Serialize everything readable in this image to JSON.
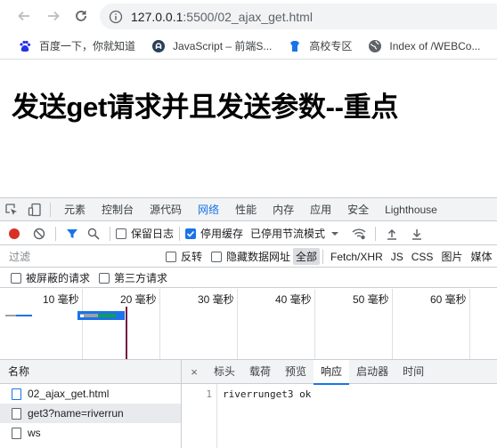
{
  "browser": {
    "url_host": "127.0.0.1",
    "url_path": ":5500/02_ajax_get.html"
  },
  "bookmarks": [
    {
      "label": "百度一下，你就知道",
      "icon": "baidu-icon"
    },
    {
      "label": "JavaScript – 前端S...",
      "icon": "site-icon"
    },
    {
      "label": "高校专区",
      "icon": "tshirt-icon"
    },
    {
      "label": "Index of /WEBCo...",
      "icon": "globe-icon"
    }
  ],
  "page": {
    "heading": "发送get请求并且发送参数--重点"
  },
  "devtools": {
    "tabs": [
      "元素",
      "控制台",
      "源代码",
      "网络",
      "性能",
      "内存",
      "应用",
      "安全",
      "Lighthouse"
    ],
    "active_tab": "网络",
    "toolbar": {
      "preserve_log": "保留日志",
      "disable_cache": "停用缓存",
      "throttling": "已停用节流模式"
    },
    "filter": {
      "placeholder": "过滤",
      "invert": "反转",
      "hide_data_urls": "隐藏数据网址",
      "types": [
        "全部",
        "Fetch/XHR",
        "JS",
        "CSS",
        "图片",
        "媒体"
      ],
      "active_type": "全部",
      "blocked_requests": "被屏蔽的请求",
      "third_party": "第三方请求"
    },
    "timeline": {
      "ticks": [
        "10 毫秒",
        "20 毫秒",
        "30 毫秒",
        "40 毫秒",
        "50 毫秒",
        "60 毫秒"
      ]
    },
    "requests": {
      "header": "名称",
      "rows": [
        {
          "name": "02_ajax_get.html",
          "selected": false
        },
        {
          "name": "get3?name=riverrun",
          "selected": true
        },
        {
          "name": "ws",
          "selected": false
        }
      ]
    },
    "detail": {
      "close": "×",
      "tabs": [
        "标头",
        "载荷",
        "预览",
        "响应",
        "启动器",
        "时间"
      ],
      "active_tab": "响应",
      "line_number": "1",
      "response_text": "riverrunget3 ok"
    }
  },
  "colors": {
    "accent": "#1a73e8",
    "record": "#d93025"
  }
}
